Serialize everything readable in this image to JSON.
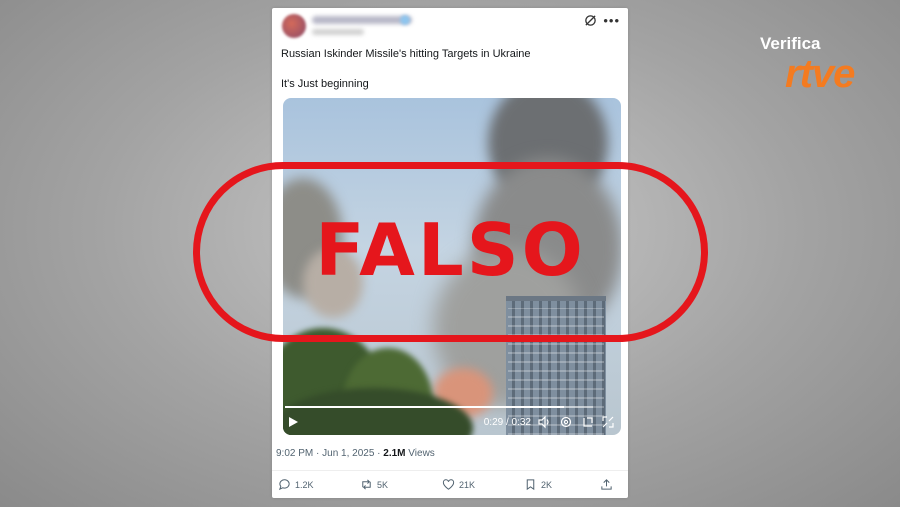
{
  "tweet": {
    "text_line1": "Russian Iskinder Missile's hitting Targets in Ukraine",
    "text_line2": "It's Just beginning",
    "video": {
      "time": "0:29 / 0:32",
      "progress": 0.906
    },
    "meta": {
      "datetime": "9:02 PM · Jun 1, 2025 · ",
      "views_count": "2.1M",
      "views_label": " Views"
    },
    "actions": {
      "replies": "1.2K",
      "reposts": "5K",
      "likes": "21K",
      "bookmarks": "2K"
    }
  },
  "stamp": {
    "label": "FALSO",
    "color": "#e5161c"
  },
  "brand": {
    "verifica": "Verifica",
    "rtve": "rtve",
    "rtve_color": "#f47b20"
  }
}
